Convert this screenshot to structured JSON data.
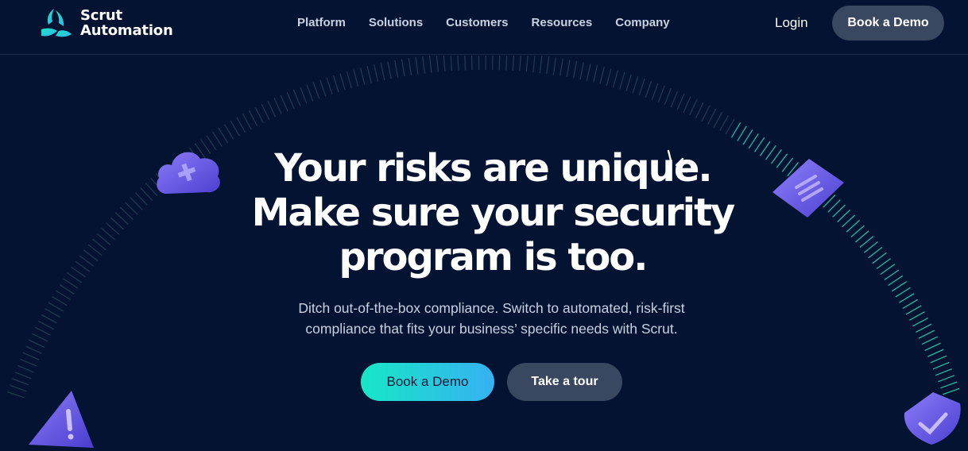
{
  "header": {
    "logo_line1": "Scrut",
    "logo_line2": "Automation",
    "nav": [
      "Platform",
      "Solutions",
      "Customers",
      "Resources",
      "Company"
    ],
    "login_label": "Login",
    "demo_label": "Book a Demo"
  },
  "hero": {
    "title_line1": "Your risks are unique.",
    "title_line2": "Make sure your security",
    "title_line3": "program is too.",
    "subtitle_line1": "Ditch out-of-the-box compliance. Switch to automated, risk-first",
    "subtitle_line2": "compliance that fits your business’ specific needs with Scrut.",
    "primary_cta": "Book a Demo",
    "secondary_cta": "Take a tour"
  },
  "colors": {
    "background": "#031331",
    "accent_teal": "#17e7c6",
    "accent_blue": "#36b1f2",
    "button_gray": "#3a4760",
    "badge_purple": "#6b5ff0"
  },
  "icons": [
    "scrut-logo-icon",
    "cloud-icon",
    "document-icon",
    "warning-icon",
    "shield-check-icon",
    "sparkle-icon"
  ]
}
